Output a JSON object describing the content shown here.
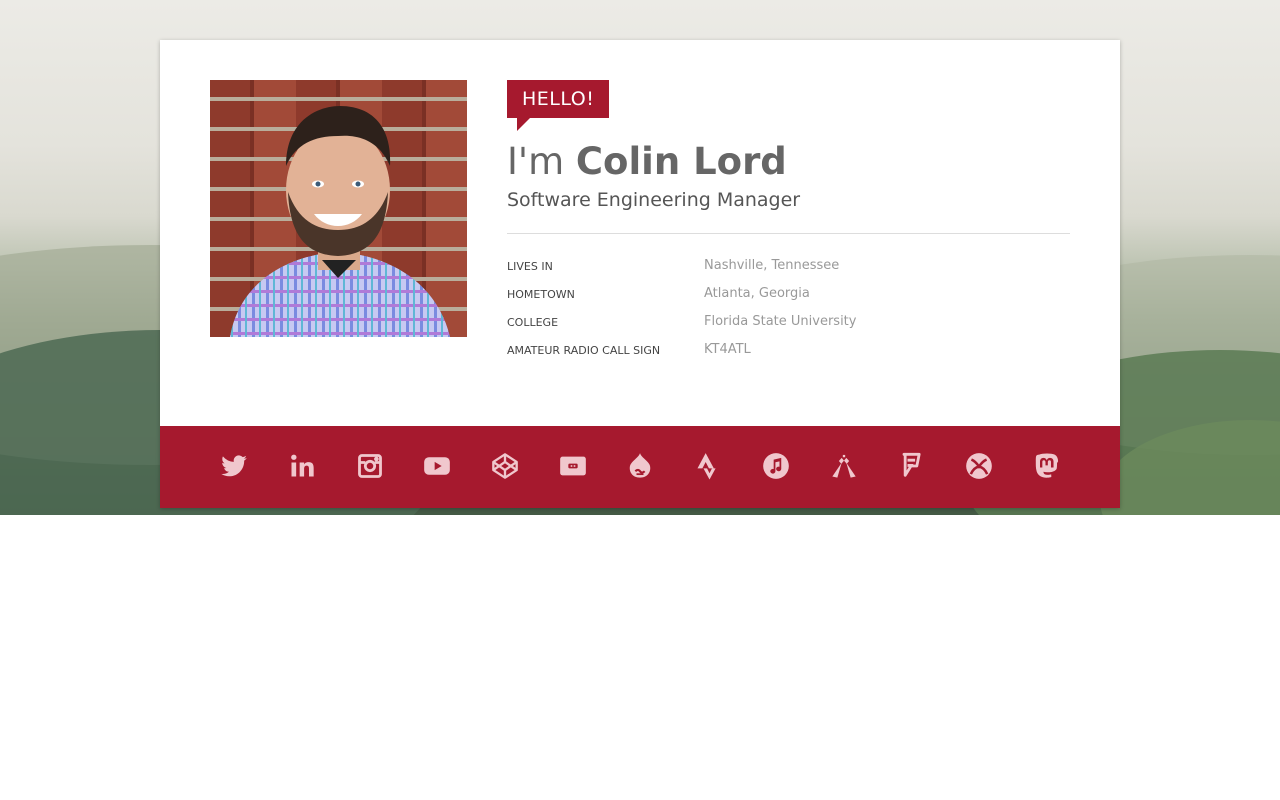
{
  "profile": {
    "hello": "HELLO!",
    "greeting": "I'm",
    "name": "Colin Lord",
    "title": "Software Engineering Manager",
    "photo": "profile-photo"
  },
  "facts": [
    {
      "label": "Lives in",
      "value": "Nashville, Tennessee"
    },
    {
      "label": "Hometown",
      "value": "Atlanta, Georgia"
    },
    {
      "label": "College",
      "value": "Florida State University"
    },
    {
      "label": "Amateur Radio Call Sign",
      "value": "KT4ATL"
    }
  ],
  "social": [
    {
      "icon": "twitter-icon"
    },
    {
      "icon": "linkedin-icon"
    },
    {
      "icon": "instagram-icon"
    },
    {
      "icon": "youtube-icon"
    },
    {
      "icon": "codepen-icon"
    },
    {
      "icon": "tv-icon"
    },
    {
      "icon": "drupal-icon"
    },
    {
      "icon": "strava-icon"
    },
    {
      "icon": "itunes-icon"
    },
    {
      "icon": "untappd-icon"
    },
    {
      "icon": "foursquare-icon"
    },
    {
      "icon": "xbox-icon"
    },
    {
      "icon": "mastodon-icon"
    }
  ],
  "colors": {
    "accent": "#a6192e",
    "icon": "#f0c7cd"
  }
}
